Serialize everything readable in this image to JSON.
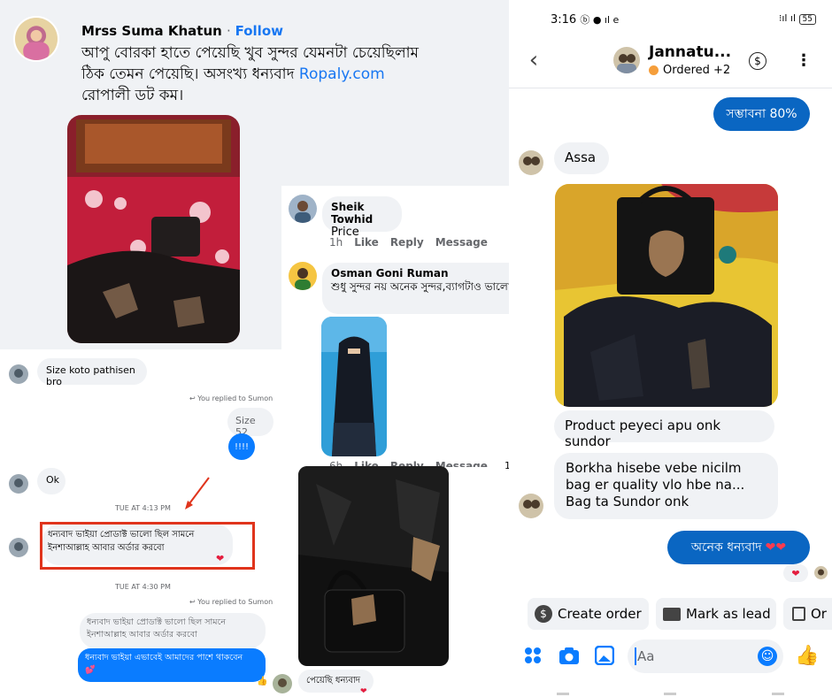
{
  "fb_post": {
    "author": "Mrss Suma Khatun",
    "follow": "Follow",
    "text_main": "আপু বোরকা হাতে পেয়েছি খুব সুন্দর যেমনটা চেয়েছিলাম ঠিক তেমন পেয়েছি। অসংখ্য ধন্যবাদ ",
    "text_link": "Ropaly.com",
    "text_tail": "রোপালী ডট কম।"
  },
  "fb_comments": [
    {
      "author": "Sheik Towhid",
      "text": "Price",
      "time": "1h",
      "like": "Like",
      "reply": "Reply",
      "message": "Message"
    },
    {
      "author": "Osman Goni Ruman",
      "text": "শুধু সুন্দর নয় অনেক সুন্দর,ব্যাগটাও ভালো।",
      "time": "6h",
      "like": "Like",
      "reply": "Reply",
      "message": "Message"
    }
  ],
  "chat1": {
    "msg_size_q": "Size koto pathisen bro",
    "replied_to_1": "You replied to Sumon",
    "quoted_size": "Size 52",
    "outgoing_bang": "!!!!",
    "msg_ok": "Ok",
    "ts1": "TUE AT 4:13 PM",
    "msg_thanks": "ধন্যবাদ ভাইয়া প্রোডাক্ট ভালো ছিল সামনে ইনশাআল্লাহ আবার অর্ডার করবো",
    "ts2": "TUE AT 4:30 PM",
    "replied_to_2": "You replied to Sumon",
    "quoted_thanks": "ধন্যবাদ ভাইয়া প্রোডাক্ট ভালো ছিল সামনে ইনশাআল্লাহ আবার অর্ডার করবো",
    "outgoing_reply": "ধন্যবাদ ভাইয়া এভাবেই আমাদের পাশে থাকবেন"
  },
  "chat_mid": {
    "caption": "পেয়েছি ধন্যবাদ",
    "reaction_count": "1"
  },
  "phone": {
    "status_time": "3:16",
    "status_icons": "ⓑ ● ıl e",
    "battery": "55",
    "contact_name": "Jannatu...",
    "contact_status": "Ordered +2",
    "msg_probability": "সম্ভাবনা 80%",
    "msg_assa": "Assa",
    "msg_product": "Product peyeci apu onk sundor",
    "msg_borkha": "Borkha hisebe vebe nicilm bag er quality vlo hbe na... Bag ta Sundor onk",
    "msg_thanks": "অনেক ধন্যবাদ",
    "action_create_order": "Create order",
    "action_mark_lead": "Mark as lead",
    "action_more": "Or",
    "composer_placeholder": "Aa"
  },
  "colors": {
    "fb_blue": "#1877f2",
    "messenger_blue": "#0a66c2",
    "bubble_gray": "#f0f2f5",
    "highlight_red": "#e0341c"
  }
}
